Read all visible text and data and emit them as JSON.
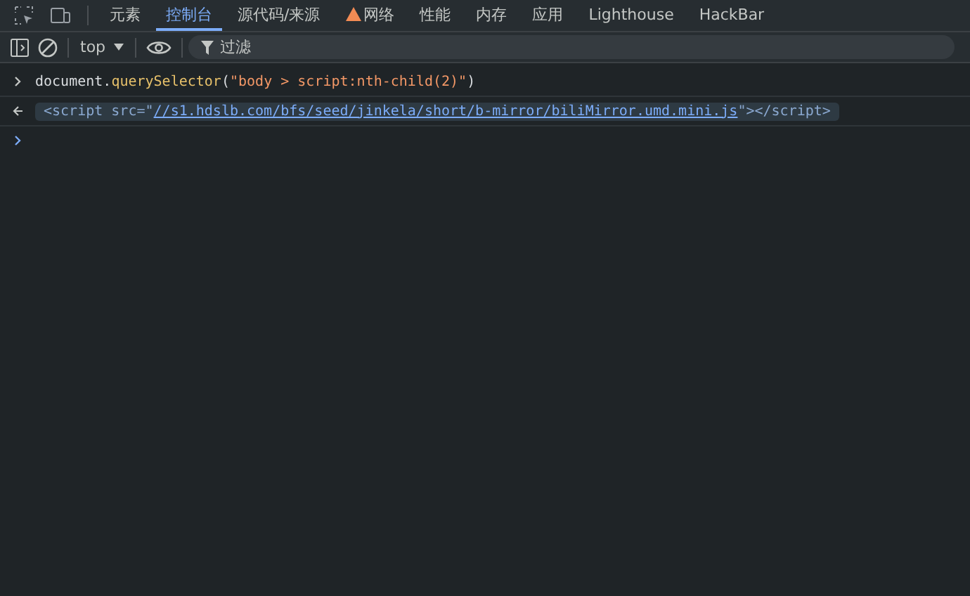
{
  "tabs": [
    {
      "label": "元素",
      "selected": false,
      "warning": false
    },
    {
      "label": "控制台",
      "selected": true,
      "warning": false
    },
    {
      "label": "源代码/来源",
      "selected": false,
      "warning": false
    },
    {
      "label": "网络",
      "selected": false,
      "warning": true
    },
    {
      "label": "性能",
      "selected": false,
      "warning": false
    },
    {
      "label": "内存",
      "selected": false,
      "warning": false
    },
    {
      "label": "应用",
      "selected": false,
      "warning": false
    },
    {
      "label": "Lighthouse",
      "selected": false,
      "warning": false
    },
    {
      "label": "HackBar",
      "selected": false,
      "warning": false
    }
  ],
  "toolbar": {
    "context": "top",
    "filter": {
      "placeholder": "过滤"
    }
  },
  "console": [
    {
      "kind": "input",
      "tokens": [
        {
          "kind": "plain",
          "text": "document."
        },
        {
          "kind": "method",
          "text": "querySelector"
        },
        {
          "kind": "plain",
          "text": "("
        },
        {
          "kind": "string",
          "text": "\"body > script:nth-child(2)\""
        },
        {
          "kind": "plain",
          "text": ")"
        }
      ]
    },
    {
      "kind": "output",
      "tokens": [
        {
          "kind": "tag",
          "text": "<script src="
        },
        {
          "kind": "tag",
          "text": "\""
        },
        {
          "kind": "link",
          "text": "//s1.hdslb.com/bfs/seed/jinkela/short/b-mirror/biliMirror.umd.mini.js"
        },
        {
          "kind": "tag",
          "text": "\"></script>"
        }
      ]
    }
  ]
}
